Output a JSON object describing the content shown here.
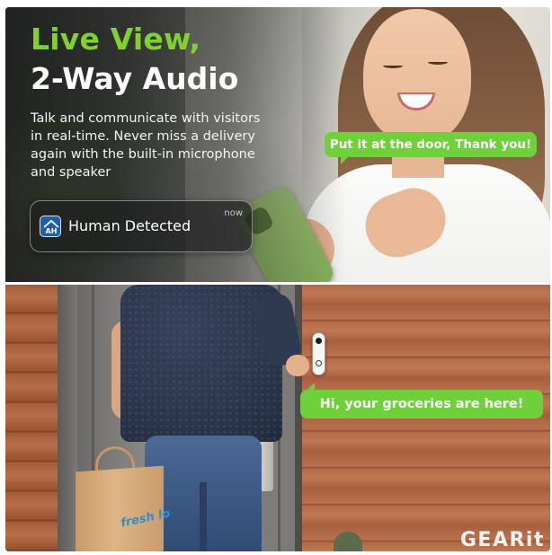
{
  "hero": {
    "headline_line1": "Live View,",
    "headline_line2": "2-Way Audio",
    "description_lines": [
      "Talk and communicate with visitors",
      "in real-time. Never miss a delivery",
      "again with the built-in microphone",
      "and speaker"
    ]
  },
  "notification": {
    "title": "Human Detected",
    "time": "now",
    "icon": "ah-app-icon"
  },
  "speech": {
    "top_bubble": "Put it at the door, Thank you!",
    "bottom_bubble": "Hi, your groceries are here!"
  },
  "bag": {
    "text": "fresh lo"
  },
  "brand": {
    "logo": "GEARit"
  },
  "colors": {
    "accent_green": "#7fd12e",
    "bubble_green": "#6fd13a",
    "notification_bg": "#1e2020"
  }
}
